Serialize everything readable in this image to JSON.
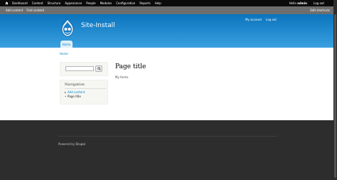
{
  "toolbar": {
    "menu": [
      "Dashboard",
      "Content",
      "Structure",
      "Appearance",
      "People",
      "Modules",
      "Configuration",
      "Reports",
      "Help"
    ],
    "hello_prefix": "Hello ",
    "username": "admin",
    "logout": "Log out"
  },
  "shortcuts": {
    "items": [
      "Add content",
      "Find content"
    ],
    "edit": "Edit shortcuts"
  },
  "header": {
    "site_name": "Site-Install",
    "secondary_links": [
      "My account",
      "Log out"
    ],
    "tab": "Home"
  },
  "breadcrumb": "Home",
  "search": {
    "value": ""
  },
  "navigation": {
    "title": "Navigation",
    "items": [
      "Add content",
      "Page title"
    ]
  },
  "content": {
    "title": "Page title",
    "body": "My forms"
  },
  "footer": {
    "powered_prefix": "Powered by ",
    "powered_link": "Drupal"
  },
  "colors": {
    "header_top": "#0a74bd",
    "header_bottom": "#3aa0e0",
    "link": "#0088cc",
    "footer_bg": "#2d2d2d"
  }
}
